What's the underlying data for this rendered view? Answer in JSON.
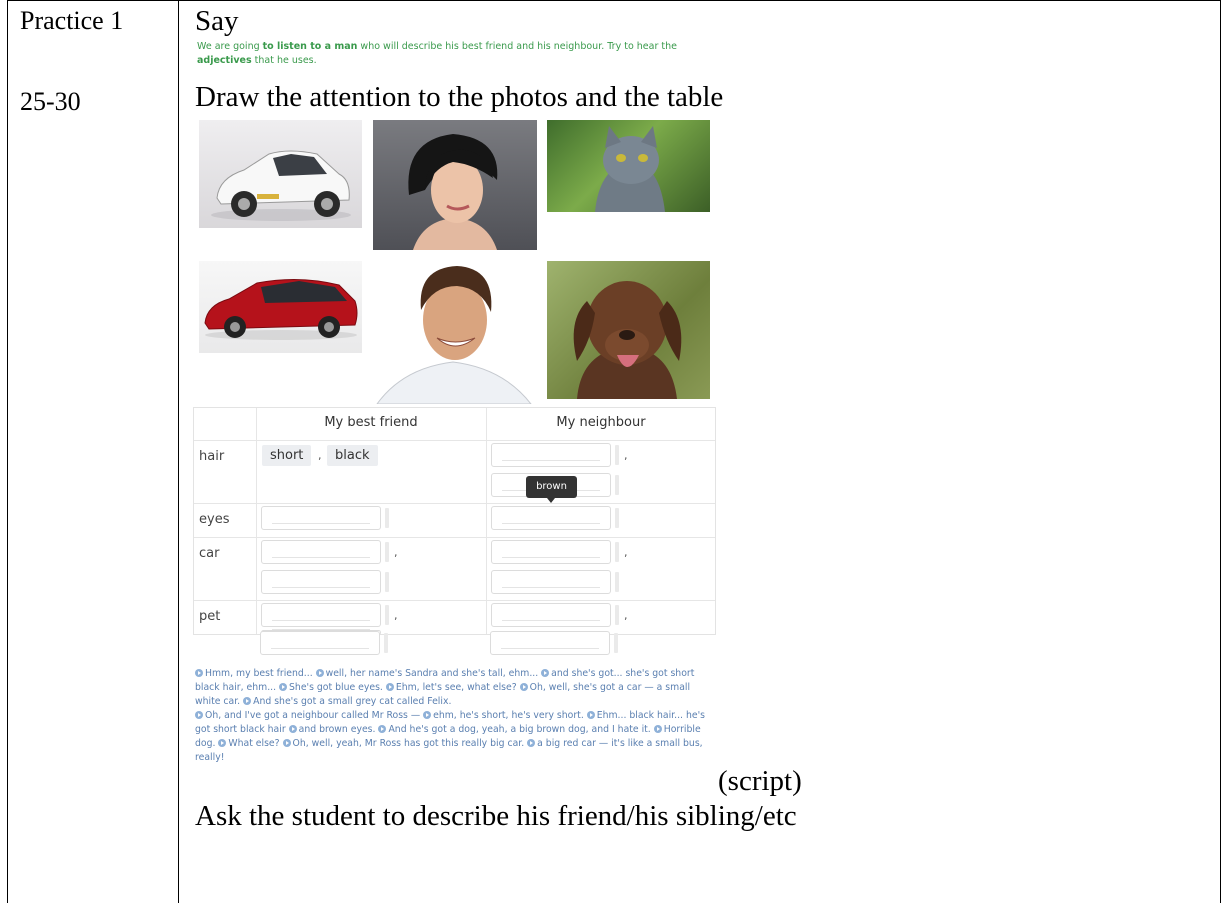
{
  "left_column": {
    "practice_label": "Practice 1",
    "time_label": "25-30"
  },
  "say_label": "Say",
  "instruction": {
    "part1": "We are going ",
    "bold1": "to listen to a man",
    "part2": " who will describe his best friend and his neighbour. Try to hear the",
    "bold2": "adjectives",
    "part3": " that he uses."
  },
  "draw_attention": "Draw the attention to the photos and the table",
  "table": {
    "headers": [
      "My best friend",
      "My neighbour"
    ],
    "rows": [
      "hair",
      "eyes",
      "car",
      "pet"
    ],
    "filled_hair_best_friend": [
      "short",
      "black"
    ],
    "separator": ",",
    "tooltip": "brown"
  },
  "script_lines": [
    "Hmm, my best friend... ",
    "well, her name's Sandra and she's tall, ehm... ",
    "and she's got... she's got short black hair, ehm... ",
    "She's got blue eyes. ",
    "Ehm, let's see, what else? ",
    "Oh, well, she's got a car — a small white car. ",
    "And she's got a small grey cat called Felix. ",
    "Oh, and I've got a neighbour called Mr Ross — ",
    "ehm, he's short, he's very short. ",
    "Ehm... black hair... he's got short black hair ",
    "and brown eyes. ",
    "And he's got a dog, yeah, a big brown dog, and I hate it. ",
    "Horrible dog. ",
    "What else? ",
    "Oh, well, yeah, Mr Ross has got this really big car. ",
    "a big red car — it's like a small bus, really!"
  ],
  "script_label": "(script)",
  "ask_student": "Ask the student to describe his friend/his sibling/etc"
}
